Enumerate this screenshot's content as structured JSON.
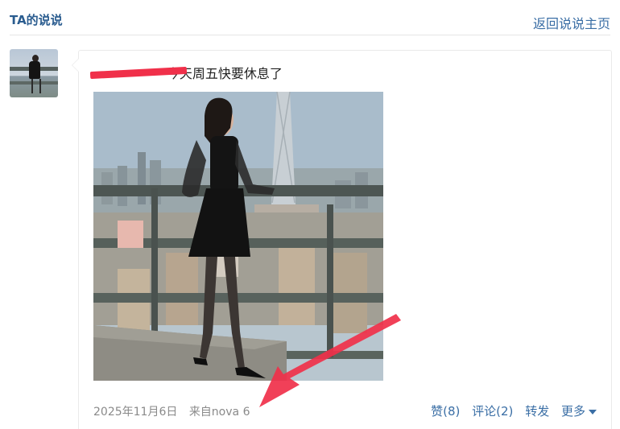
{
  "header": {
    "title": "TA的说说",
    "back_link": "返回说说主页"
  },
  "post": {
    "author": " ",
    "separator": "-",
    "text": "今天周五快要休息了",
    "date": "2025年11月6日",
    "source": "来自nova 6",
    "actions": {
      "like": "赞(8)",
      "comment": "评论(2)",
      "forward": "转发",
      "more": "更多"
    }
  },
  "colors": {
    "link": "#3a6ea5",
    "title": "#2a5c8f",
    "annotation": "#f0304a"
  }
}
